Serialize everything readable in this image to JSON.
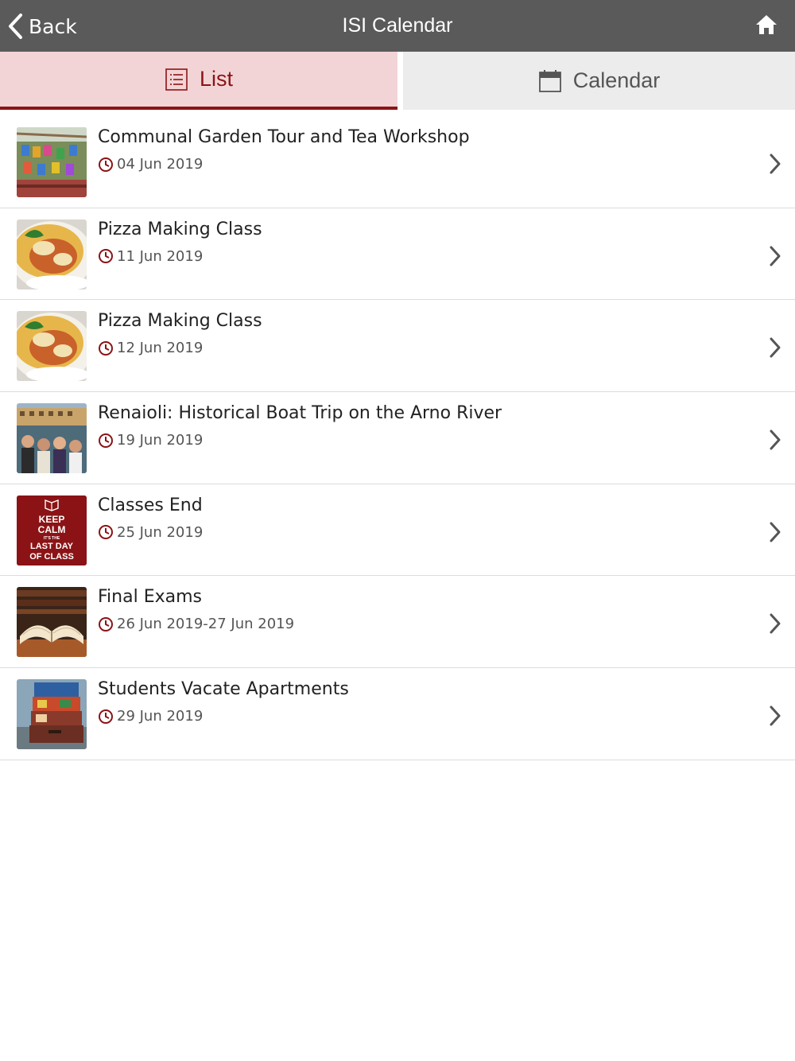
{
  "header": {
    "back_label": "Back",
    "title": "ISI Calendar"
  },
  "tabs": {
    "list_label": "List",
    "calendar_label": "Calendar"
  },
  "colors": {
    "accent": "#8b1316",
    "topbar": "#5a5a5a",
    "active_tab_bg": "#f2d4d6"
  },
  "events": [
    {
      "title": "Communal Garden Tour and Tea Workshop",
      "date": "04 Jun 2019",
      "image": "garden-photo"
    },
    {
      "title": "Pizza Making Class",
      "date": "11 Jun 2019",
      "image": "pizza-photo"
    },
    {
      "title": "Pizza Making Class",
      "date": "12 Jun 2019",
      "image": "pizza-photo"
    },
    {
      "title": "Renaioli: Historical Boat Trip on the Arno River",
      "date": "19 Jun 2019",
      "image": "boat-trip-photo"
    },
    {
      "title": "Classes End",
      "date": "25 Jun 2019",
      "image": "keep-calm-poster",
      "poster_text": {
        "line1": "KEEP",
        "line2": "CALM",
        "line3": "IT'S THE",
        "line4": "LAST DAY",
        "line5": "OF CLASS"
      }
    },
    {
      "title": "Final Exams",
      "date": "26 Jun 2019-27 Jun 2019",
      "image": "open-book-photo"
    },
    {
      "title": "Students Vacate Apartments",
      "date": "29 Jun 2019",
      "image": "suitcases-photo"
    }
  ]
}
